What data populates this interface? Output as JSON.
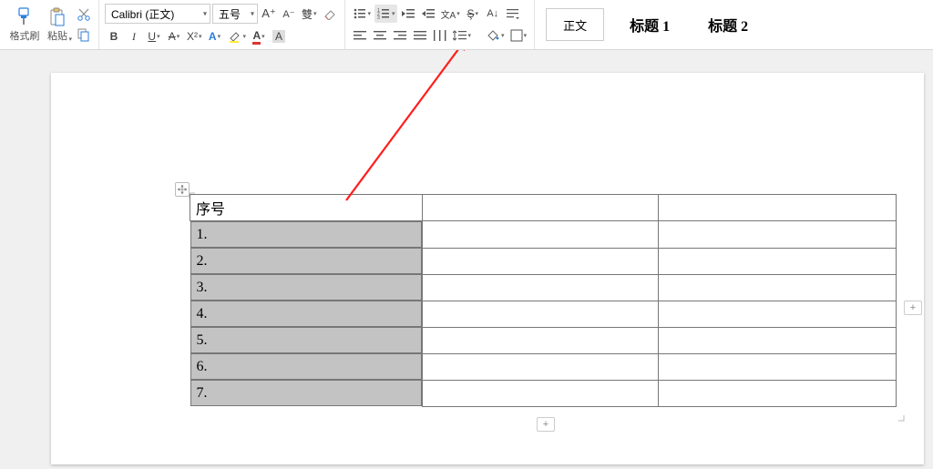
{
  "ribbon": {
    "format_painter": "格式刷",
    "paste": "粘贴",
    "font_name": "Calibri (正文)",
    "font_size": "五号",
    "styles_normal": "正文",
    "styles_h1": "标题 1",
    "styles_h2": "标题 2"
  },
  "table": {
    "header": "序号",
    "rows": [
      "1.",
      "2.",
      "3.",
      "4.",
      "5.",
      "6.",
      "7."
    ]
  }
}
